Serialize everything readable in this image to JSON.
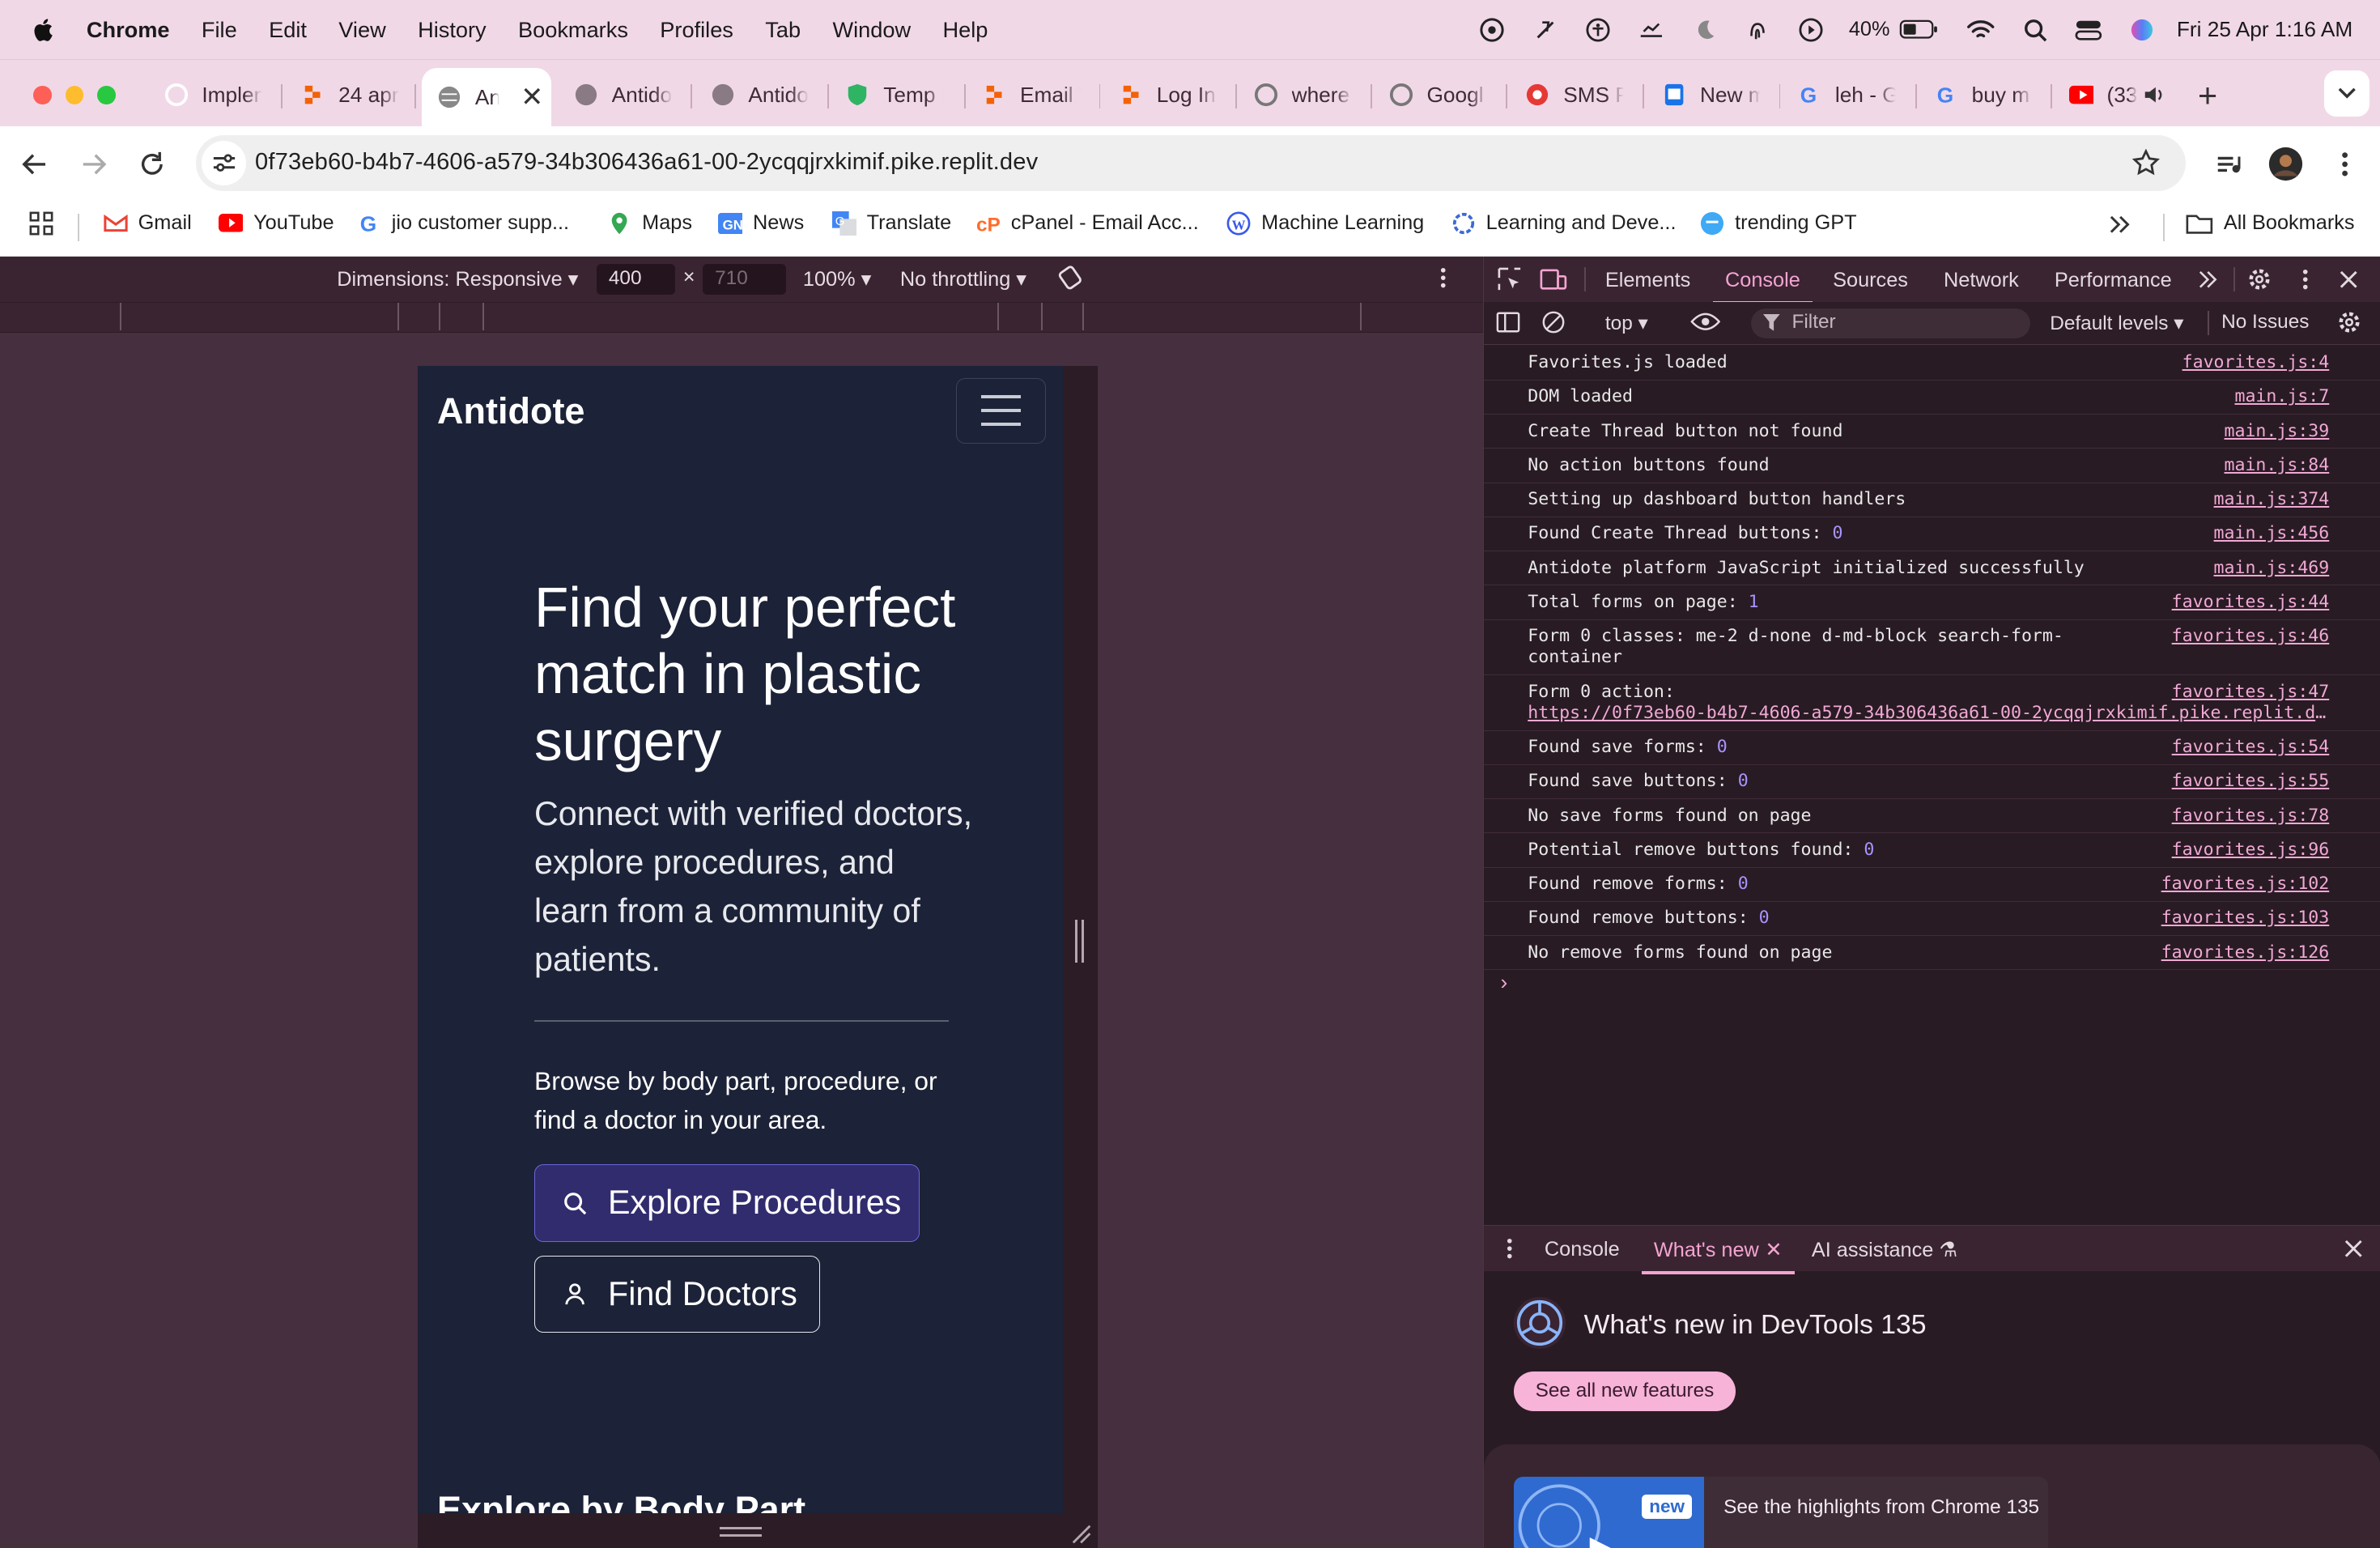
{
  "menubar": {
    "app": "Chrome",
    "menus": [
      "File",
      "Edit",
      "View",
      "History",
      "Bookmarks",
      "Profiles",
      "Tab",
      "Window",
      "Help"
    ],
    "battery": "40%",
    "clock": "Fri 25 Apr  1:16 AM"
  },
  "tabs": [
    {
      "title": "Implen",
      "icon": "circle-icon"
    },
    {
      "title": "24 apr",
      "icon": "replit-icon"
    },
    {
      "title": "An",
      "icon": "globe-icon",
      "active": true
    },
    {
      "title": "Antido",
      "icon": "globe-icon"
    },
    {
      "title": "Antido",
      "icon": "globe-icon"
    },
    {
      "title": "Temp I",
      "icon": "shield-icon"
    },
    {
      "title": "Email V",
      "icon": "replit-icon"
    },
    {
      "title": "Log In",
      "icon": "replit-icon"
    },
    {
      "title": "where",
      "icon": "google-icon"
    },
    {
      "title": "Googl",
      "icon": "google-icon"
    },
    {
      "title": "SMS P",
      "icon": "sms-icon"
    },
    {
      "title": "New m",
      "icon": "doc-icon"
    },
    {
      "title": "leh - G",
      "icon": "google-icon"
    },
    {
      "title": "buy m",
      "icon": "google-icon"
    },
    {
      "title": "(33",
      "icon": "youtube-icon"
    }
  ],
  "toolbar": {
    "url": "0f73eb60-b4b7-4606-a579-34b306436a61-00-2ycqqjrxkimif.pike.replit.dev"
  },
  "bookmarks": {
    "items": [
      {
        "label": "Gmail",
        "icon": "gmail-icon"
      },
      {
        "label": "YouTube",
        "icon": "youtube-icon"
      },
      {
        "label": "jio customer supp...",
        "icon": "google-icon"
      },
      {
        "label": "Maps",
        "icon": "maps-icon"
      },
      {
        "label": "News",
        "icon": "news-icon"
      },
      {
        "label": "Translate",
        "icon": "translate-icon"
      },
      {
        "label": "cPanel - Email Acc...",
        "icon": "cpanel-icon"
      },
      {
        "label": "Machine Learning",
        "icon": "wordpress-icon"
      },
      {
        "label": "Learning and Deve...",
        "icon": "gear-icon"
      },
      {
        "label": "trending GPT",
        "icon": "chat-icon"
      }
    ],
    "all_label": "All Bookmarks"
  },
  "device_toolbar": {
    "dimensions_label": "Dimensions: Responsive",
    "width": "400",
    "height_placeholder": "710",
    "zoom": "100%",
    "throttling": "No throttling"
  },
  "page": {
    "brand": "Antidote",
    "hero_title": "Find your perfect match in plastic surgery",
    "hero_sub": "Connect with verified doctors, explore procedures, and learn from a community of patients.",
    "browse_text": "Browse by body part, procedure, or find a doctor in your area.",
    "explore_button": "Explore Procedures",
    "find_button": "Find Doctors",
    "section_title": "Explore by Body Part"
  },
  "devtools": {
    "tabs": [
      "Elements",
      "Console",
      "Sources",
      "Network",
      "Performance"
    ],
    "active_tab": "Console",
    "context": "top",
    "filter_placeholder": "Filter",
    "levels": "Default levels",
    "issues": "No Issues",
    "messages": [
      {
        "text": "Favorites.js loaded",
        "src": "favorites.js:4"
      },
      {
        "text": "DOM loaded",
        "src": "main.js:7"
      },
      {
        "text": "Create Thread button not found",
        "src": "main.js:39"
      },
      {
        "text": "No action buttons found",
        "src": "main.js:84"
      },
      {
        "text": "Setting up dashboard button handlers",
        "src": "main.js:374"
      },
      {
        "text": "Found Create Thread buttons: ",
        "num": "0",
        "src": "main.js:456"
      },
      {
        "text": "Antidote platform JavaScript initialized successfully",
        "src": "main.js:469"
      },
      {
        "text": "Total forms on page: ",
        "num": "1",
        "src": "favorites.js:44"
      },
      {
        "text": "Form 0 classes: me-2 d-none d-md-block search-form-container",
        "src": "favorites.js:46"
      },
      {
        "text": "Form 0 action: ",
        "link": "https://0f73eb60-b4b7-4606-a579-34b306436a61-00-2ycqqjrxkimif.pike.replit.dev/search",
        "src": "favorites.js:47"
      },
      {
        "text": "Found save forms: ",
        "num": "0",
        "src": "favorites.js:54"
      },
      {
        "text": "Found save buttons: ",
        "num": "0",
        "src": "favorites.js:55"
      },
      {
        "text": "No save forms found on page",
        "src": "favorites.js:78"
      },
      {
        "text": "Potential remove buttons found: ",
        "num": "0",
        "src": "favorites.js:96"
      },
      {
        "text": "Found remove forms: ",
        "num": "0",
        "src": "favorites.js:102"
      },
      {
        "text": "Found remove buttons: ",
        "num": "0",
        "src": "favorites.js:103"
      },
      {
        "text": "No remove forms found on page",
        "src": "favorites.js:126"
      }
    ],
    "drawer": {
      "tabs": [
        "Console",
        "What's new",
        "AI assistance"
      ],
      "active": "What's new",
      "title": "What's new in DevTools 135",
      "button": "See all new features",
      "badge": "new",
      "card_text": "See the highlights from Chrome 135"
    }
  }
}
